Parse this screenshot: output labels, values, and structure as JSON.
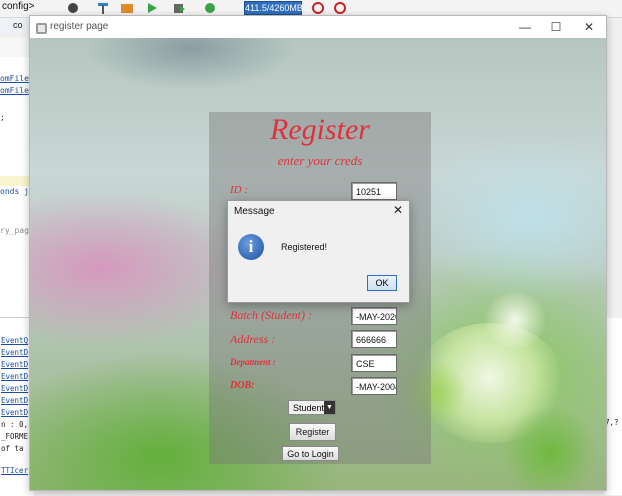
{
  "ide": {
    "config_label": "config>",
    "memory_label": "411.5/4260MB",
    "tab_label": "co",
    "left_code": [
      "omFile",
      "omFile",
      ";",
      "onds j",
      "ry_pag"
    ],
    "output_code": [
      "EventQ",
      "EventD",
      "EventD",
      "EventD",
      "EventD",
      "EventD",
      "EventD",
      "n : 0,",
      "_FORME",
      " of ta",
      "TTIcer"
    ],
    "right_code": "7,?"
  },
  "window": {
    "title": "register page",
    "minimize": "—",
    "maximize": "☐",
    "close": "✕"
  },
  "form": {
    "title": "Register",
    "subtitle": "enter your creds",
    "id_label": "ID :",
    "id_value": "10251",
    "batch_label": "Batch (Student) :",
    "batch_value": "-MAY-2026",
    "address_label": "Address :",
    "address_value": "666666",
    "department_label": "Depatment :",
    "department_value": "CSE",
    "dob_label": "DOB:",
    "dob_value": "-MAY-2004",
    "role_selected": "Student",
    "register_button": "Register",
    "login_button": "Go to Login"
  },
  "dialog": {
    "title": "Message",
    "close": "✕",
    "icon": "info-icon",
    "message": "Registered!",
    "ok_button": "OK"
  }
}
